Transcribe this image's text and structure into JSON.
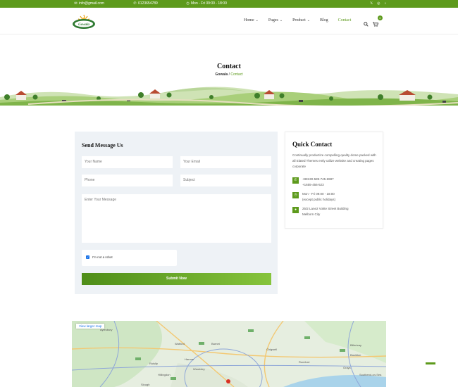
{
  "topbar": {
    "email": "info@gmail.com",
    "phone": "0123654789",
    "hours": "Mon - Fri 09:00 - 18:00",
    "social": [
      "x-icon",
      "instagram-icon",
      "tiktok-icon"
    ]
  },
  "header": {
    "logo_text": "Gowala",
    "nav": [
      {
        "label": "Home",
        "has_dropdown": true
      },
      {
        "label": "Pages",
        "has_dropdown": true
      },
      {
        "label": "Product",
        "has_dropdown": true
      },
      {
        "label": "Blog",
        "has_dropdown": false
      },
      {
        "label": "Contact",
        "has_dropdown": false,
        "active": true
      }
    ],
    "cart_count": "0"
  },
  "hero": {
    "title": "Contact",
    "breadcrumb_home": "Gowala",
    "breadcrumb_sep": " / ",
    "breadcrumb_current": "Contact"
  },
  "form": {
    "title": "Send Message Us",
    "name_placeholder": "Your Name",
    "email_placeholder": "Your Email",
    "phone_placeholder": "Phone",
    "subject_placeholder": "Subject",
    "message_placeholder": "Enter Your Message",
    "captcha_label": "I'm not a robot",
    "submit_label": "Submit Now"
  },
  "quick_contact": {
    "title": "Quick Contact",
    "text": "Continually productize compelling quality dome packed with all Elated Themes ently utilize website and creating pages corporate",
    "phone_1": "+88130-589-745-6987",
    "phone_2": "+1655-456-523",
    "hours_1": "Mon - Fri 09:00 - 18:00",
    "hours_2": "(except public holidays)",
    "address_1": "25/2 Lane2 Vokte Street Building",
    "address_2": "Melborn City"
  },
  "map": {
    "larger_map_label": "View larger map",
    "places": [
      "Watford",
      "Barnet",
      "Chigwell",
      "Grays",
      "Southend-on-Sea",
      "Slough",
      "Hillingdon",
      "Wembley",
      "Harrow",
      "Aylesbury",
      "Billericay",
      "Basildon",
      "Ruislip",
      "Romford"
    ]
  },
  "colors": {
    "brand_green": "#5d9a1c"
  }
}
